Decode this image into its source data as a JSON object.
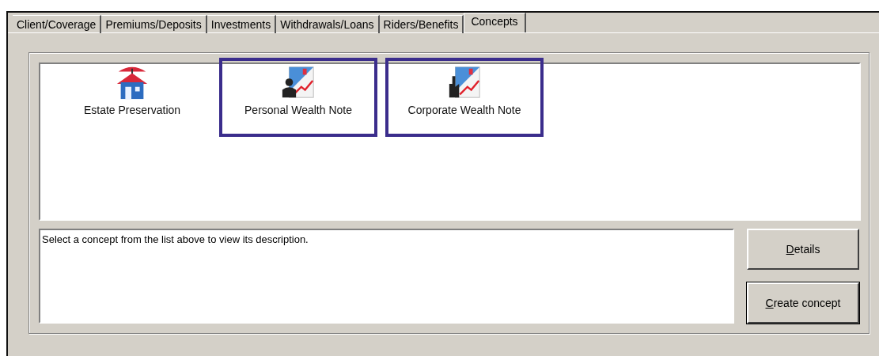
{
  "tabs": [
    {
      "label": "Client/Coverage",
      "selected": false
    },
    {
      "label": "Premiums/Deposits",
      "selected": false
    },
    {
      "label": "Investments",
      "selected": false
    },
    {
      "label": "Withdrawals/Loans",
      "selected": false
    },
    {
      "label": "Riders/Benefits",
      "selected": false
    },
    {
      "label": "Concepts",
      "selected": true
    }
  ],
  "concepts": [
    {
      "label": "Estate Preservation",
      "kind": "house",
      "highlighted": false
    },
    {
      "label": "Personal Wealth Note",
      "kind": "person",
      "highlighted": true
    },
    {
      "label": "Corporate Wealth Note",
      "kind": "factory",
      "highlighted": true
    }
  ],
  "description": "Select a concept from the list above to view its description.",
  "buttons": [
    {
      "label": "Details",
      "default": false,
      "mnemonic_underlined": true
    },
    {
      "label": "Create concept",
      "default": true,
      "mnemonic_underlined": true
    }
  ]
}
